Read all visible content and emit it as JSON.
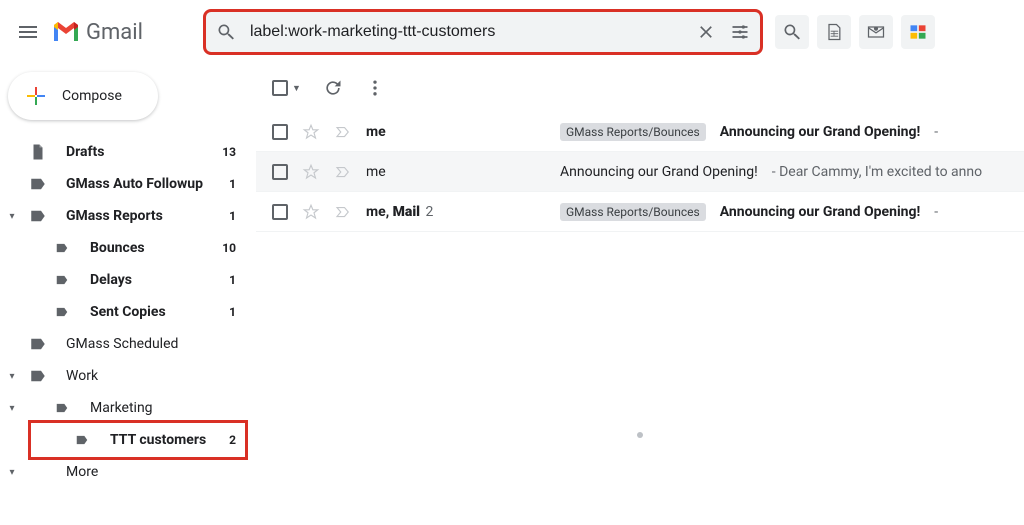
{
  "header": {
    "product": "Gmail",
    "search_value": "label:work-marketing-ttt-customers"
  },
  "compose_label": "Compose",
  "sidebar": [
    {
      "name": "drafts",
      "label": "Drafts",
      "count": "13",
      "bold": true,
      "icon": "file",
      "indent": 0,
      "expander": ""
    },
    {
      "name": "gmass-auto-followup",
      "label": "GMass Auto Followup",
      "count": "1",
      "bold": true,
      "icon": "label",
      "indent": 0,
      "expander": ""
    },
    {
      "name": "gmass-reports",
      "label": "GMass Reports",
      "count": "1",
      "bold": true,
      "icon": "label",
      "indent": 0,
      "expander": "▾"
    },
    {
      "name": "bounces",
      "label": "Bounces",
      "count": "10",
      "bold": true,
      "icon": "labelsm",
      "indent": 1,
      "expander": ""
    },
    {
      "name": "delays",
      "label": "Delays",
      "count": "1",
      "bold": true,
      "icon": "labelsm",
      "indent": 1,
      "expander": ""
    },
    {
      "name": "sent-copies",
      "label": "Sent Copies",
      "count": "1",
      "bold": true,
      "icon": "labelsm",
      "indent": 1,
      "expander": ""
    },
    {
      "name": "gmass-scheduled",
      "label": "GMass Scheduled",
      "count": "",
      "bold": false,
      "icon": "label",
      "indent": 0,
      "expander": ""
    },
    {
      "name": "work",
      "label": "Work",
      "count": "",
      "bold": false,
      "icon": "label",
      "indent": 0,
      "expander": "▾"
    },
    {
      "name": "marketing",
      "label": "Marketing",
      "count": "",
      "bold": false,
      "icon": "labelsm",
      "indent": 1,
      "expander": "▾"
    },
    {
      "name": "ttt-customers",
      "label": "TTT customers",
      "count": "2",
      "bold": true,
      "icon": "labelsm",
      "indent": 2,
      "expander": "",
      "highlight": true
    },
    {
      "name": "more",
      "label": "More",
      "count": "",
      "bold": false,
      "icon": "",
      "indent": 0,
      "expander": "▾"
    }
  ],
  "rows": [
    {
      "unread": true,
      "sender": "me",
      "sender2": "",
      "chip": "GMass Reports/Bounces",
      "subject": "Announcing our Grand Opening!",
      "snippet": " - "
    },
    {
      "unread": false,
      "sender": "me",
      "sender2": "",
      "chip": "",
      "subject": "Announcing our Grand Opening!",
      "snippet": " - Dear Cammy, I'm excited to anno"
    },
    {
      "unread": true,
      "sender": "me, ",
      "sender2": "Mail",
      "sender3": " 2",
      "chip": "GMass Reports/Bounces",
      "subject": "Announcing our Grand Opening!",
      "snippet": " - "
    }
  ]
}
